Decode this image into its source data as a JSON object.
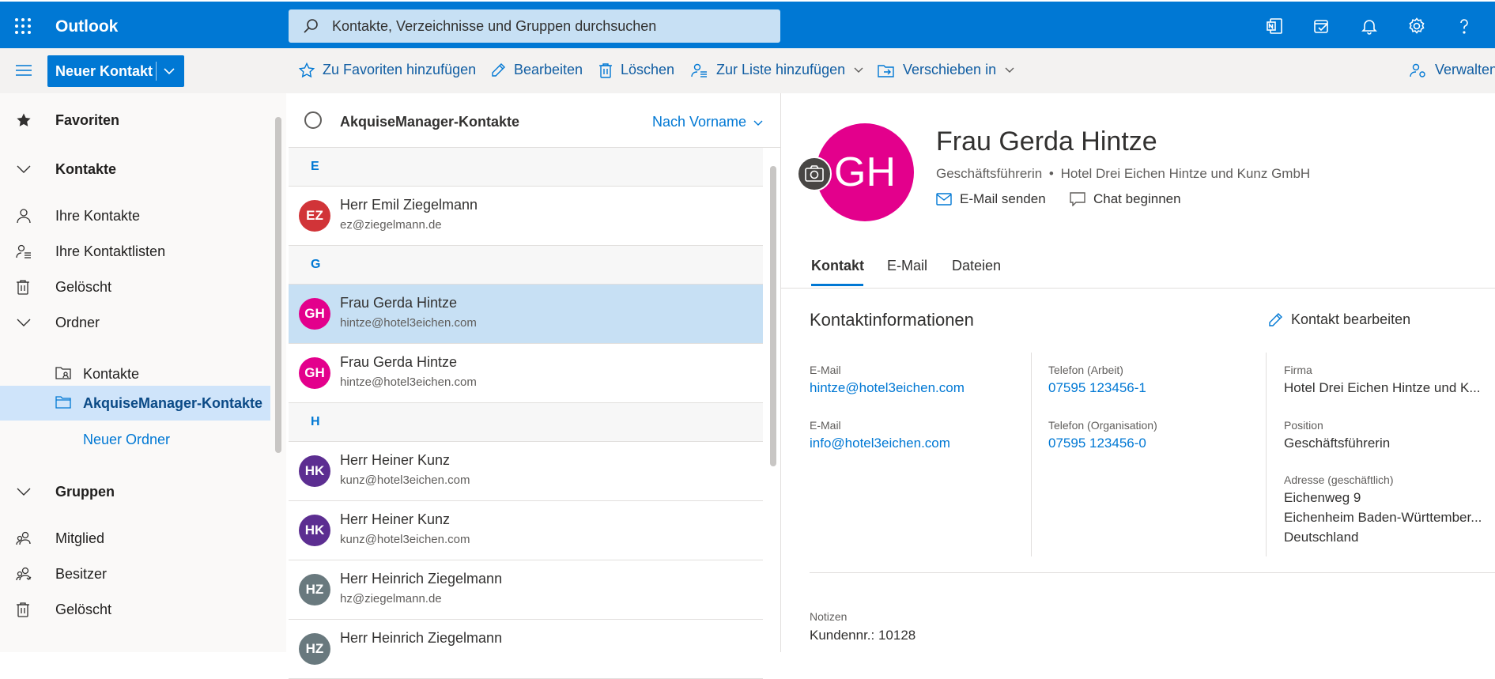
{
  "topbar": {
    "app_title": "Outlook",
    "search_placeholder": "Kontakte, Verzeichnisse und Gruppen durchsuchen",
    "icons": [
      "waffle-icon",
      "onenote-icon",
      "tasks-icon",
      "bell-icon",
      "gear-icon",
      "help-icon"
    ],
    "accent": "#0078d4"
  },
  "commandbar": {
    "new_contact": "Neuer Kontakt",
    "add_favorites": "Zu Favoriten hinzufügen",
    "edit": "Bearbeiten",
    "delete": "Löschen",
    "add_to_list": "Zur Liste hinzufügen",
    "move_to": "Verschieben in",
    "manage": "Verwalten"
  },
  "nav": {
    "favorites": "Favoriten",
    "contacts": "Kontakte",
    "your_contacts": "Ihre Kontakte",
    "your_lists": "Ihre Kontaktlisten",
    "deleted": "Gelöscht",
    "folders": "Ordner",
    "folder_contacts": "Kontakte",
    "folder_akquise": "AkquiseManager-Kontakte",
    "new_folder": "Neuer Ordner",
    "groups": "Gruppen",
    "member": "Mitglied",
    "owner": "Besitzer",
    "groups_deleted": "Gelöscht"
  },
  "list": {
    "title": "AkquiseManager-Kontakte",
    "sort": "Nach Vorname",
    "groups": [
      "E",
      "G",
      "H"
    ],
    "items": [
      {
        "initials": "EZ",
        "name": "Herr Emil Ziegelmann",
        "email": "ez@ziegelmann.de",
        "color": "#d13438"
      },
      {
        "initials": "GH",
        "name": "Frau Gerda Hintze",
        "email": "hintze@hotel3eichen.com",
        "color": "#e3008c"
      },
      {
        "initials": "GH",
        "name": "Frau Gerda Hintze",
        "email": "hintze@hotel3eichen.com",
        "color": "#e3008c"
      },
      {
        "initials": "HK",
        "name": "Herr Heiner Kunz",
        "email": "kunz@hotel3eichen.com",
        "color": "#5c2e91"
      },
      {
        "initials": "HK",
        "name": "Herr Heiner Kunz",
        "email": "kunz@hotel3eichen.com",
        "color": "#5c2e91"
      },
      {
        "initials": "HZ",
        "name": "Herr Heinrich Ziegelmann",
        "email": "hz@ziegelmann.de",
        "color": "#69797e"
      },
      {
        "initials": "HZ",
        "name": "Herr Heinrich Ziegelmann",
        "email": "",
        "color": "#69797e"
      }
    ]
  },
  "detail": {
    "initials": "GH",
    "name": "Frau Gerda Hintze",
    "role": "Geschäftsführerin",
    "company": "Hotel Drei Eichen Hintze und Kunz GmbH",
    "dot": "•",
    "send_mail": "E-Mail senden",
    "start_chat": "Chat beginnen",
    "tabs": [
      "Kontakt",
      "E-Mail",
      "Dateien"
    ],
    "section_title": "Kontaktinformationen",
    "edit_contact": "Kontakt bearbeiten",
    "email_label": "E-Mail",
    "email1": "hintze@hotel3eichen.com",
    "email2": "info@hotel3eichen.com",
    "phone_work_label": "Telefon (Arbeit)",
    "phone_work": "07595 123456-1",
    "phone_org_label": "Telefon (Organisation)",
    "phone_org": "07595 123456-0",
    "company_label": "Firma",
    "company_value": "Hotel Drei Eichen Hintze und K...",
    "position_label": "Position",
    "position_value": "Geschäftsführerin",
    "address_label": "Adresse (geschäftlich)",
    "address_line1": "Eichenweg 9",
    "address_line2": "Eichenheim Baden-Württember...",
    "address_line3": "Deutschland",
    "notes_label": "Notizen",
    "notes_value": "Kundennr.: 10128"
  }
}
